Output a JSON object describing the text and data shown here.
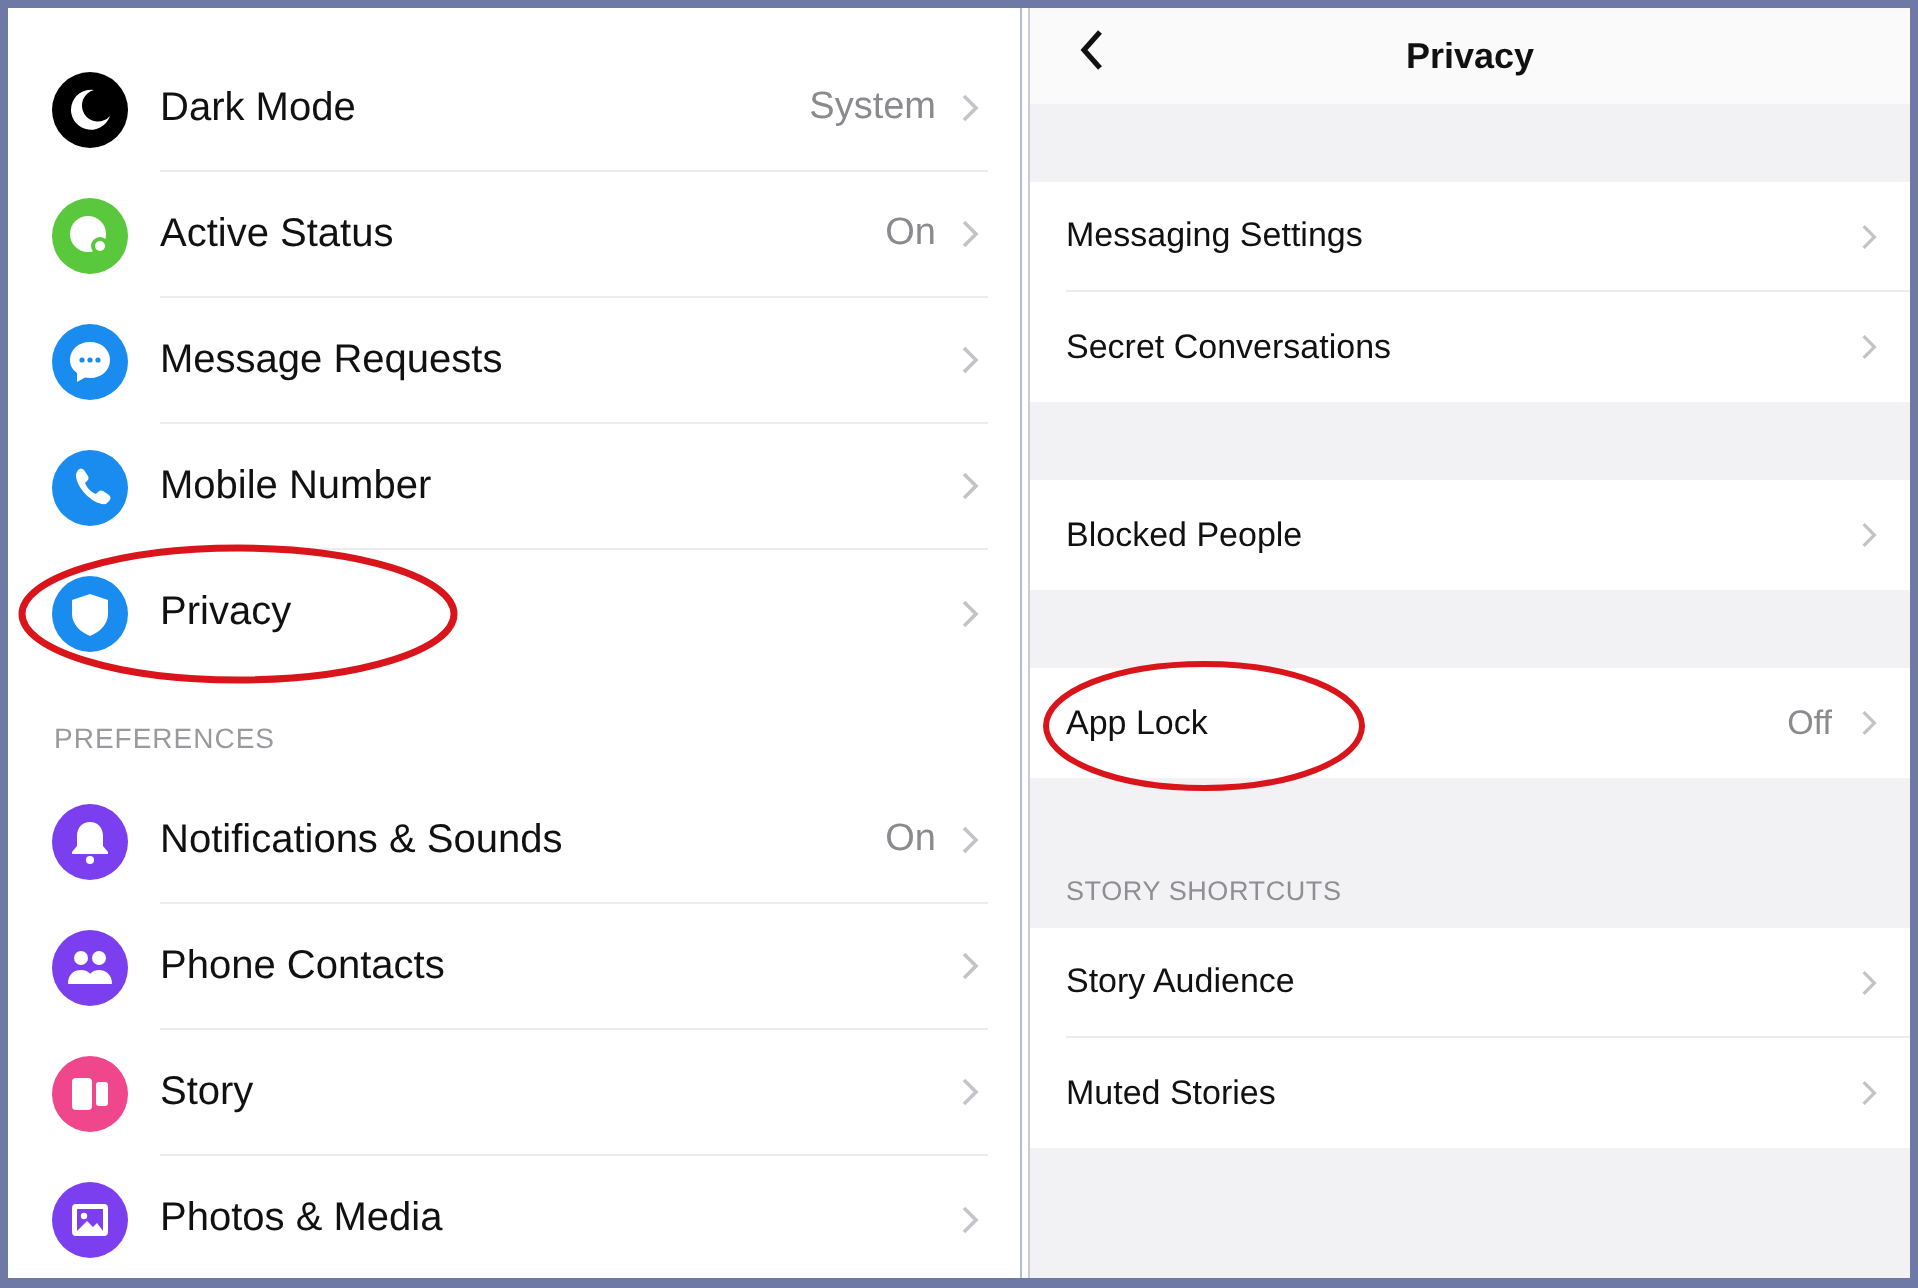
{
  "left_panel": {
    "sections": [
      {
        "items": [
          {
            "label": "Dark Mode",
            "value": "System",
            "kind": "moon",
            "color": "#000000",
            "highlighted": false
          },
          {
            "label": "Active Status",
            "value": "On",
            "kind": "status",
            "color": "#5ac83c",
            "highlighted": false
          },
          {
            "label": "Message Requests",
            "kind": "chat",
            "color": "#1a8cf0",
            "highlighted": false
          },
          {
            "label": "Mobile Number",
            "kind": "phone",
            "color": "#1a8cf0",
            "highlighted": false
          },
          {
            "label": "Privacy",
            "kind": "shield",
            "color": "#1a8cf0",
            "highlighted": true
          }
        ]
      },
      {
        "header": "PREFERENCES",
        "items": [
          {
            "label": "Notifications & Sounds",
            "value": "On",
            "kind": "bell",
            "color": "#7b3ff0",
            "highlighted": false
          },
          {
            "label": "Phone Contacts",
            "kind": "people",
            "color": "#7b3ff0",
            "highlighted": false
          },
          {
            "label": "Story",
            "kind": "story",
            "color": "#f0468c",
            "highlighted": false
          },
          {
            "label": "Photos & Media",
            "kind": "photo",
            "color": "#7b3ff0",
            "highlighted": false
          }
        ]
      }
    ]
  },
  "right_panel": {
    "header": {
      "title": "Privacy"
    },
    "groups": [
      {
        "items": [
          {
            "label": "Messaging Settings",
            "highlighted": false
          },
          {
            "label": "Secret Conversations",
            "highlighted": false
          }
        ]
      },
      {
        "items": [
          {
            "label": "Blocked People",
            "highlighted": false
          }
        ]
      },
      {
        "items": [
          {
            "label": "App Lock",
            "value": "Off",
            "highlighted": true
          }
        ]
      },
      {
        "header": "STORY SHORTCUTS",
        "items": [
          {
            "label": "Story Audience",
            "highlighted": false
          },
          {
            "label": "Muted Stories",
            "highlighted": false
          }
        ]
      }
    ]
  }
}
